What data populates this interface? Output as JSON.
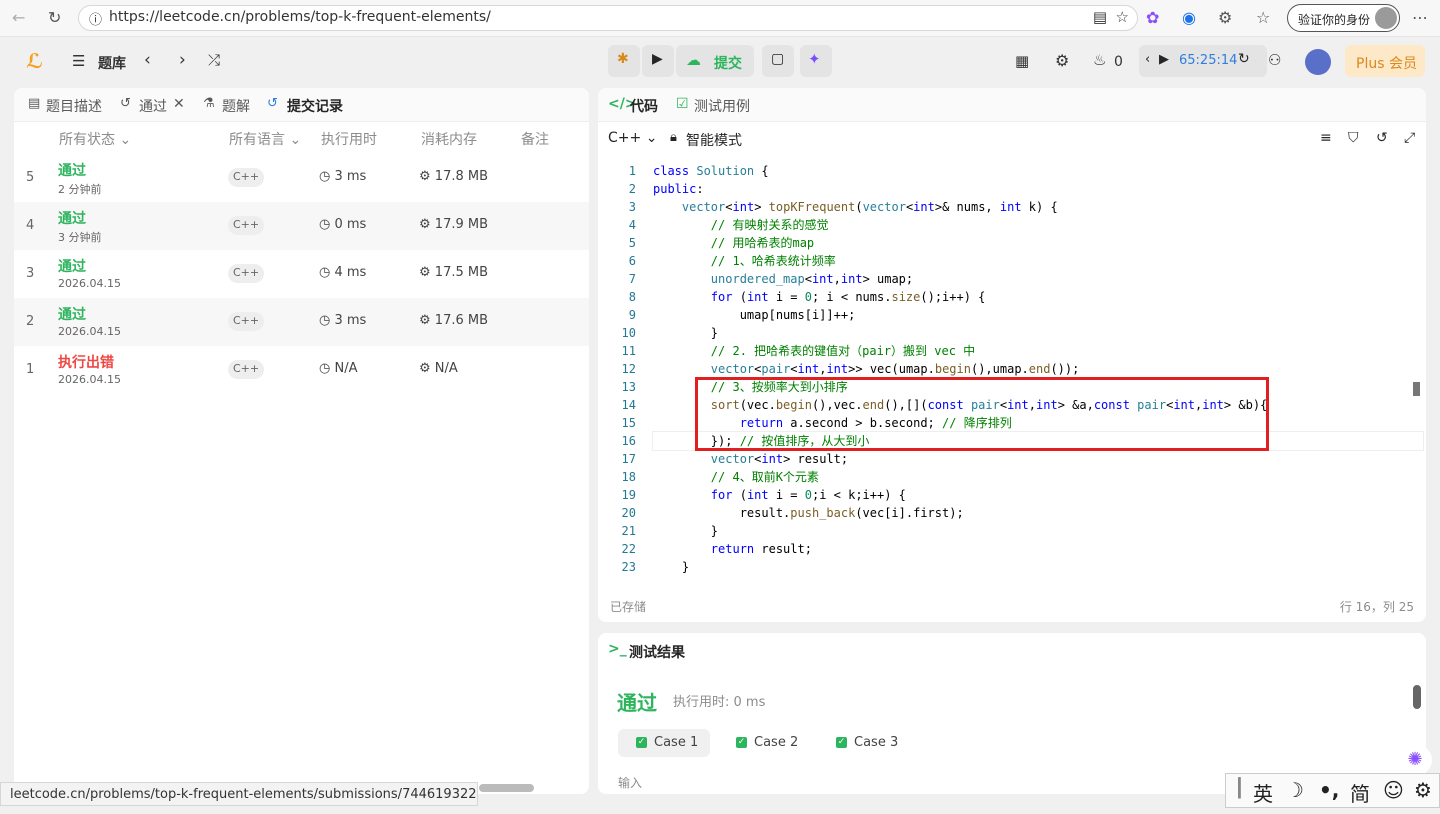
{
  "browser": {
    "url": "https://leetcode.cn/problems/top-k-frequent-elements/",
    "verify_label": "验证你的身份",
    "status_url": "leetcode.cn/problems/top-k-frequent-elements/submissions/744619322"
  },
  "topbar": {
    "problems_label": "题库",
    "submit_label": "提交",
    "streak": "0",
    "timer": "65:25:14",
    "plus_label": "Plus 会员"
  },
  "left": {
    "tabs": [
      "题目描述",
      "通过",
      "题解",
      "提交记录"
    ],
    "headers": [
      "所有状态",
      "所有语言",
      "执行用时",
      "消耗内存",
      "备注"
    ],
    "rows": [
      {
        "num": "5",
        "status": "通过",
        "time": "2 分钟前",
        "lang": "C++",
        "runtime": "3 ms",
        "memory": "17.8 MB"
      },
      {
        "num": "4",
        "status": "通过",
        "time": "3 分钟前",
        "lang": "C++",
        "runtime": "0 ms",
        "memory": "17.9 MB"
      },
      {
        "num": "3",
        "status": "通过",
        "time": "2026.04.15",
        "lang": "C++",
        "runtime": "4 ms",
        "memory": "17.5 MB"
      },
      {
        "num": "2",
        "status": "通过",
        "time": "2026.04.15",
        "lang": "C++",
        "runtime": "3 ms",
        "memory": "17.6 MB"
      },
      {
        "num": "1",
        "status": "执行出错",
        "time": "2026.04.15",
        "lang": "C++",
        "runtime": "N/A",
        "memory": "N/A"
      }
    ]
  },
  "editor": {
    "tab_code": "代码",
    "tab_testcases": "测试用例",
    "language": "C++",
    "mode": "智能模式",
    "saved": "已存储",
    "cursor": "行 16，列 25",
    "lines": [
      "class Solution {",
      "public:",
      "    vector<int> topKFrequent(vector<int>& nums, int k) {",
      "        // 有映射关系的感觉",
      "        // 用哈希表的map",
      "        // 1、哈希表统计频率",
      "        unordered_map<int,int> umap;",
      "        for (int i = 0; i < nums.size();i++) {",
      "            umap[nums[i]]++;",
      "        }",
      "        // 2. 把哈希表的键值对（pair）搬到 vec 中",
      "        vector<pair<int,int>> vec(umap.begin(),umap.end());",
      "        // 3、按频率大到小排序",
      "        sort(vec.begin(),vec.end(),[](const pair<int,int> &a,const pair<int,int> &b){",
      "            return a.second > b.second; // 降序排列",
      "        }); // 按值排序，从大到小",
      "        vector<int> result;",
      "        // 4、取前K个元素",
      "        for (int i = 0;i < k;i++) {",
      "            result.push_back(vec[i].first);",
      "        }",
      "        return result;",
      "    }"
    ]
  },
  "results": {
    "title": "测试结果",
    "status": "通过",
    "runtime": "执行用时: 0 ms",
    "cases": [
      "Case 1",
      "Case 2",
      "Case 3"
    ],
    "input_label": "输入"
  },
  "ime": {
    "lang": "英",
    "punct": "•,",
    "mode": "简"
  },
  "colors": {
    "accept": "#2db55d",
    "error": "#ef4743",
    "highlight": "#ffff00",
    "box": "#e02020"
  }
}
